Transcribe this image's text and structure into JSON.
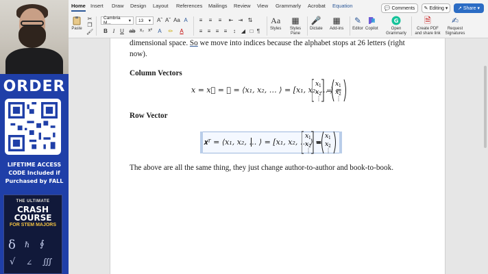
{
  "ad": {
    "order_label": "ORDER",
    "access_line1": "LIFETIME ACCESS",
    "access_line2": "CODE Included if",
    "access_line3": "Purchased by FALL",
    "book_top": "THE ULTIMATE",
    "book_title": "CRASH COURSE",
    "book_subtitle": "FOR STEM MAJORS"
  },
  "ribbon": {
    "tabs": [
      "Home",
      "Insert",
      "Draw",
      "Design",
      "Layout",
      "References",
      "Mailings",
      "Review",
      "View",
      "Grammarly",
      "Acrobat",
      "Equation"
    ],
    "active_tab": "Home",
    "comments_label": "Comments",
    "editing_label": "Editing",
    "share_label": "Share",
    "paste_label": "Paste",
    "font_name": "Cambria M...",
    "font_size": "13",
    "styles_label": "Styles",
    "styles_pane_label": "Styles Pane",
    "dictate_label": "Dictate",
    "addins_label": "Add-ins",
    "editor_label": "Editor",
    "copilot_label": "Copilot",
    "grammarly_label": "Open Grammarly",
    "create_pdf_label": "Create PDF and share link",
    "signatures_label": "Request Signatures"
  },
  "document": {
    "para1_line1_pre": "dimensional space. ",
    "para1_line1_link": "So",
    "para1_line1_post": " we move into indices because the alphabet stops at 26 letters (right",
    "para1_line2": "now).",
    "heading1": "Column Vectors",
    "heading2": "Row Vector",
    "col_eq_lhs": "x = x⃗ = 𝐱 = ⟨x₁, x₂, … ⟩ = [x₁, x₂, … ) =",
    "row_eq_lhs": "𝐱ᵀ = ⟨x₁, x₂, … ⟩ = [x₁, x₂, … ⟩ =",
    "closing": "The above are all the same thing, they just change author-to-author and book-to-book."
  },
  "colors": {
    "ribbon_bg": "#f3f3f3",
    "accent": "#2b5797",
    "share_bg": "#2b6cc4",
    "ad_bg": "#1f3fa8"
  }
}
